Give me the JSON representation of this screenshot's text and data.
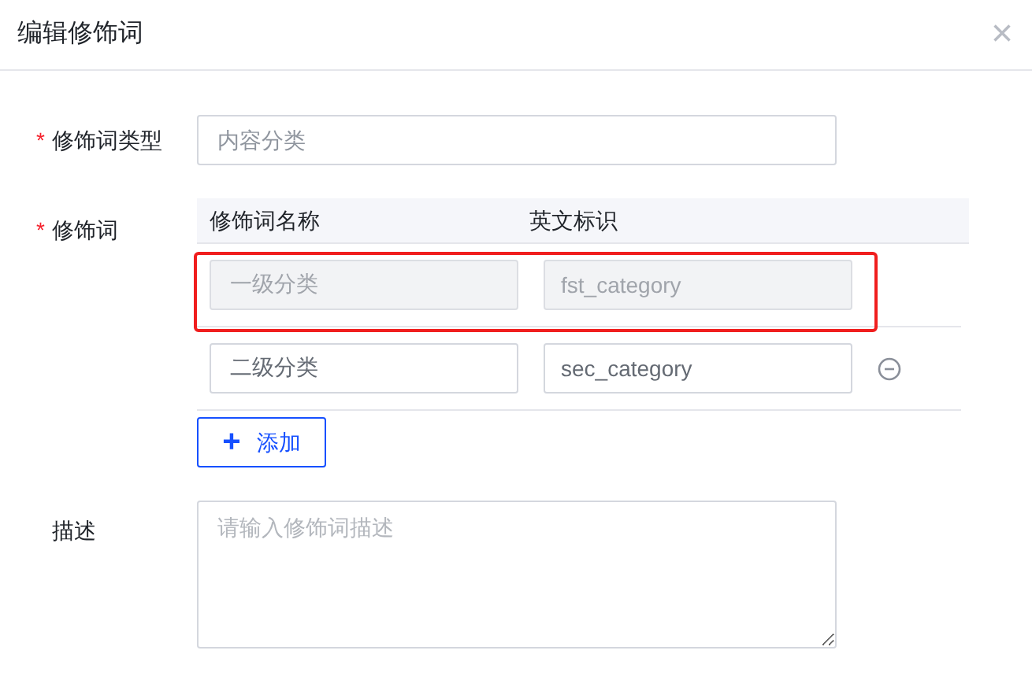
{
  "dialog": {
    "title": "编辑修饰词",
    "close": "×"
  },
  "type_field": {
    "required_mark": "*",
    "label": "修饰词类型",
    "placeholder": "内容分类"
  },
  "modifiers": {
    "required_mark": "*",
    "label": "修饰词",
    "columns": [
      "修饰词名称",
      "英文标识"
    ],
    "rows": [
      {
        "name": "一级分类",
        "key": "fst_category",
        "disabled": true,
        "highlighted": true,
        "removable": false
      },
      {
        "name": "二级分类",
        "key": "sec_category",
        "disabled": false,
        "highlighted": false,
        "removable": true
      }
    ],
    "add_button": {
      "icon": "+",
      "label": "添加"
    }
  },
  "description": {
    "label": "描述",
    "placeholder": "请输入修饰词描述"
  }
}
